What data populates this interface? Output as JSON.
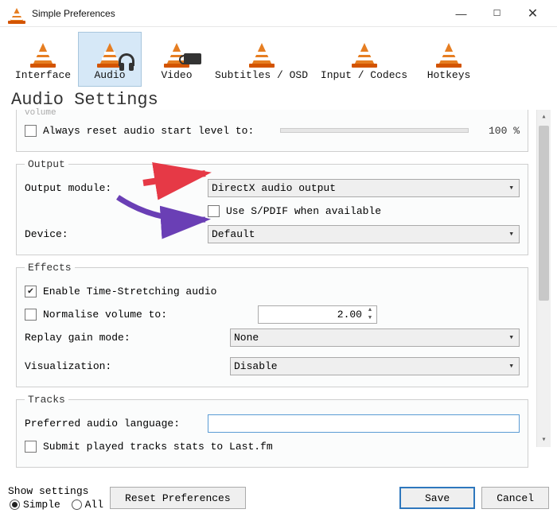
{
  "window": {
    "title": "Simple Preferences"
  },
  "tabs": [
    {
      "label": "Interface"
    },
    {
      "label": "Audio"
    },
    {
      "label": "Video"
    },
    {
      "label": "Subtitles / OSD"
    },
    {
      "label": "Input / Codecs"
    },
    {
      "label": "Hotkeys"
    }
  ],
  "page_title": "Audio Settings",
  "volume": {
    "clipped_label": "volume",
    "reset_label": "Always reset audio start level to:",
    "value_text": "100 %"
  },
  "output": {
    "legend": "Output",
    "module_label": "Output module:",
    "module_value": "DirectX audio output",
    "spdif_label": "Use S/PDIF when available",
    "device_label": "Device:",
    "device_value": "Default"
  },
  "effects": {
    "legend": "Effects",
    "timestretch_label": "Enable Time-Stretching audio",
    "normalise_label": "Normalise volume to:",
    "normalise_value": "2.00",
    "replay_label": "Replay gain mode:",
    "replay_value": "None",
    "viz_label": "Visualization:",
    "viz_value": "Disable"
  },
  "tracks": {
    "legend": "Tracks",
    "lang_label": "Preferred audio language:",
    "lang_value": "",
    "lastfm_label": "Submit played tracks stats to Last.fm"
  },
  "footer": {
    "show_label": "Show settings",
    "simple": "Simple",
    "all": "All",
    "reset": "Reset Preferences",
    "save": "Save",
    "cancel": "Cancel"
  }
}
